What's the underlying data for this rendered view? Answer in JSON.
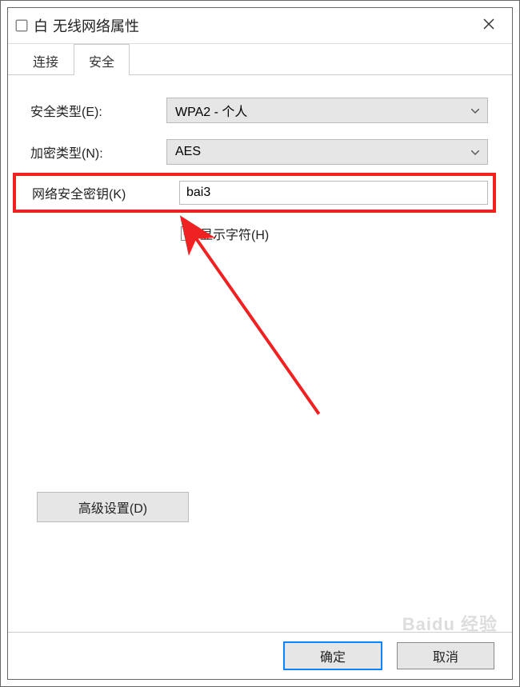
{
  "window": {
    "title_prefix": "白",
    "title": "无线网络属性"
  },
  "tabs": {
    "connect": "连接",
    "security": "安全"
  },
  "form": {
    "security_type_label": "安全类型(E):",
    "security_type_value": "WPA2 - 个人",
    "encryption_label": "加密类型(N):",
    "encryption_value": "AES",
    "key_label": "网络安全密钥(K)",
    "key_value": "bai3",
    "show_chars_label": "显示字符(H)",
    "show_chars_checked": true
  },
  "buttons": {
    "advanced": "高级设置(D)",
    "ok": "确定",
    "cancel": "取消"
  },
  "watermark": "Baidu 经验"
}
